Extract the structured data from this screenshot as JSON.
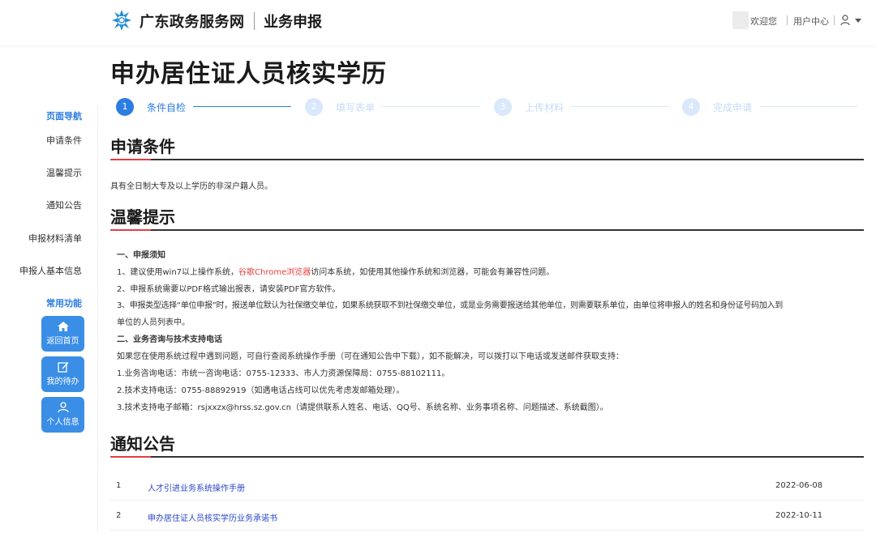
{
  "header": {
    "brand": "广东政务服务网",
    "sub_brand": "业务申报",
    "welcome": "欢迎您",
    "user_center": "用户中心"
  },
  "page_title": "申办居住证人员核实学历",
  "sidebar": {
    "nav_title": "页面导航",
    "items": [
      {
        "label": "申请条件"
      },
      {
        "label": "温馨提示"
      },
      {
        "label": "通知公告"
      },
      {
        "label": "申报材料清单"
      },
      {
        "label": "申报人基本信息"
      }
    ],
    "quick_title": "常用功能",
    "quick_buttons": [
      {
        "label": "返回首页",
        "icon": "home-icon"
      },
      {
        "label": "我的待办",
        "icon": "edit-icon"
      },
      {
        "label": "个人信息",
        "icon": "person-icon"
      }
    ]
  },
  "steps": [
    {
      "num": "1",
      "label": "条件自检",
      "active": true
    },
    {
      "num": "2",
      "label": "填写表单",
      "active": false
    },
    {
      "num": "3",
      "label": "上传材料",
      "active": false
    },
    {
      "num": "4",
      "label": "完成申请",
      "active": false
    }
  ],
  "sections": {
    "conditions": {
      "title": "申请条件",
      "text": "具有全日制大专及以上学历的非深户籍人员。"
    },
    "tips": {
      "title": "温馨提示",
      "h1": "一、申报须知",
      "l1_pre": "1、建议使用win7以上操作系统，",
      "l1_red": "谷歌Chrome浏览器",
      "l1_post": "访问本系统，如使用其他操作系统和浏览器，可能会有兼容性问题。",
      "l2": "2、申报系统需要以PDF格式输出报表，请安装PDF官方软件。",
      "l3a": "3、申报类型选择“单位申报”时，报送单位默认为社保缴交单位，如果系统获取不到社保缴交单位，或是业务需要报送给其他单位，则需要联系单位，由单位将申报人的姓名和身份证号码加入到",
      "l3b": "单位的人员列表中。",
      "h2": "二、业务咨询与技术支持电话",
      "l4": "如果您在使用系统过程中遇到问题，可自行查阅系统操作手册（可在通知公告中下载），如不能解决，可以拨打以下电话或发送邮件获取支持：",
      "l5": "1.业务咨询电话：市统一咨询电话：0755-12333、市人力资源保障局：0755-88102111。",
      "l6": "2.技术支持电话：0755-88892919（如遇电话占线可以优先考虑发邮箱处理）。",
      "l7": "3.技术支持电子邮箱：rsjxxzx@hrss.sz.gov.cn（请提供联系人姓名、电话、QQ号、系统名称、业务事项名称、问题描述、系统截图）。"
    },
    "notices": {
      "title": "通知公告",
      "rows": [
        {
          "num": "1",
          "title": "人才引进业务系统操作手册",
          "date": "2022-06-08"
        },
        {
          "num": "2",
          "title": "申办居住证人员核实学历业务承诺书",
          "date": "2022-10-11"
        }
      ]
    }
  },
  "colors": {
    "accent": "#2b7de1",
    "red": "#e53e3e",
    "link": "#2b47c7"
  }
}
